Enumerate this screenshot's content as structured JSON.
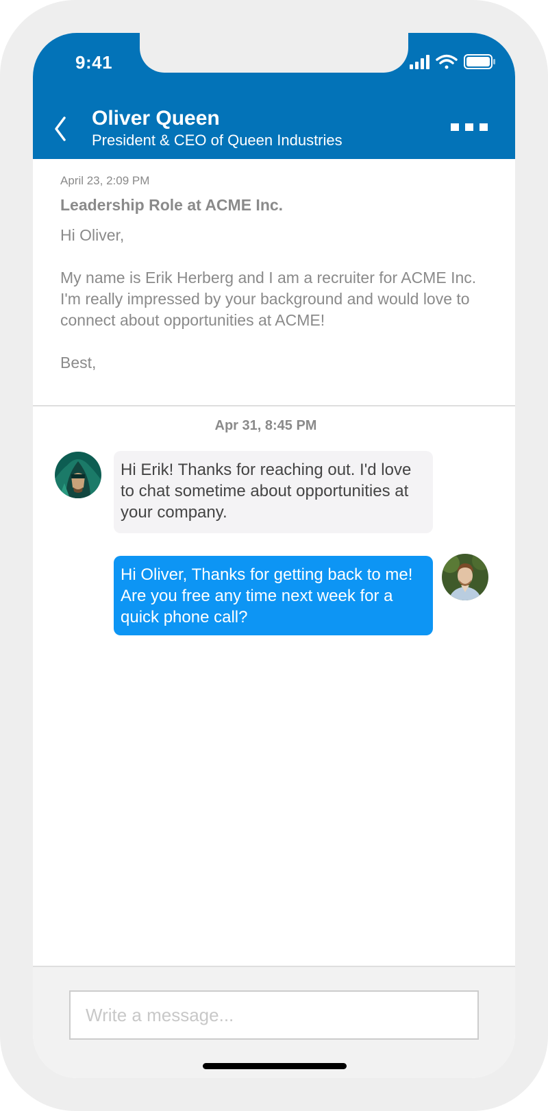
{
  "status_bar": {
    "time": "9:41"
  },
  "header": {
    "contact_name": "Oliver Queen",
    "contact_title": "President & CEO of Queen Industries",
    "brand_color": "#0373b8"
  },
  "email": {
    "date": "April 23, 2:09 PM",
    "subject": "Leadership Role at ACME Inc.",
    "greeting": "Hi Oliver,",
    "body": "My name is Erik Herberg and I am a recruiter for ACME Inc. I'm really impressed by your background and would love to connect about opportunities at ACME!",
    "closing": "Best,"
  },
  "chat": {
    "date": "Apr 31, 8:45 PM",
    "messages": [
      {
        "text": "Hi Erik! Thanks for reaching out. I'd love to chat sometime about opportunities at your company."
      },
      {
        "text": "Hi Oliver, Thanks for getting back to me! Are you free any time next week for a quick phone call?"
      }
    ],
    "outgoing_color": "#0d95f4",
    "incoming_color": "#f4f3f5"
  },
  "composer": {
    "placeholder": "Write a message...",
    "value": ""
  }
}
